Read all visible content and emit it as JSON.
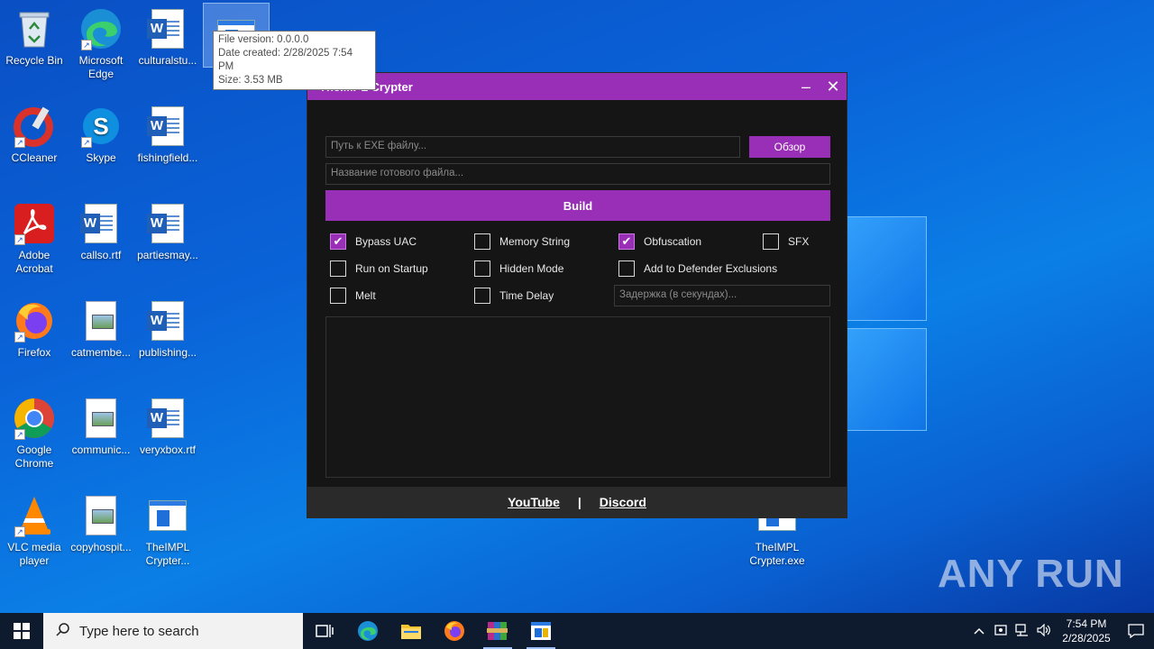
{
  "desktop": {
    "icons": [
      {
        "label": "Recycle Bin"
      },
      {
        "label": "Microsoft Edge"
      },
      {
        "label": "culturalstu..."
      },
      {
        "label": "CCleaner"
      },
      {
        "label": "Skype"
      },
      {
        "label": "fishingfield..."
      },
      {
        "label": "Adobe Acrobat"
      },
      {
        "label": "callso.rtf"
      },
      {
        "label": "partiesmay..."
      },
      {
        "label": "Firefox"
      },
      {
        "label": "catmembe..."
      },
      {
        "label": "publishing..."
      },
      {
        "label": "Google Chrome"
      },
      {
        "label": "communic..."
      },
      {
        "label": "veryxbox.rtf"
      },
      {
        "label": "VLC media player"
      },
      {
        "label": "copyhospit..."
      },
      {
        "label": "TheIMPL Crypter..."
      },
      {
        "label": "TheIMPL Crypter.exe"
      }
    ],
    "tooltip": {
      "line1": "File version: 0.0.0.0",
      "line2": "Date created: 2/28/2025 7:54 PM",
      "line3": "Size: 3.53 MB"
    },
    "watermark": "ANY RUN"
  },
  "app": {
    "title": "TheIMPL Crypter",
    "minimize_glyph": "‒",
    "close_glyph": "✕",
    "exe_path_placeholder": "Путь к EXE файлу...",
    "browse_label": "Обзор",
    "output_name_placeholder": "Название готового файла...",
    "build_label": "Build",
    "options": {
      "bypass_uac": {
        "label": "Bypass UAC",
        "checked": true
      },
      "memory_string": {
        "label": "Memory String",
        "checked": false
      },
      "obfuscation": {
        "label": "Obfuscation",
        "checked": true
      },
      "sfx": {
        "label": "SFX",
        "checked": false
      },
      "run_on_startup": {
        "label": "Run on Startup",
        "checked": false
      },
      "hidden_mode": {
        "label": "Hidden Mode",
        "checked": false
      },
      "defender_exclusions": {
        "label": "Add to Defender Exclusions",
        "checked": false
      },
      "melt": {
        "label": "Melt",
        "checked": false
      },
      "time_delay": {
        "label": "Time Delay",
        "checked": false
      }
    },
    "delay_placeholder": "Задержка (в секундах)...",
    "check_glyph": "✔",
    "footer": {
      "youtube": "YouTube",
      "separator": "|",
      "discord": "Discord"
    }
  },
  "taskbar": {
    "search_placeholder": "Type here to search",
    "time": "7:54 PM",
    "date": "2/28/2025"
  },
  "colors": {
    "accent": "#9a2fb7",
    "window_bg": "#151515",
    "taskbar": "#0e1a2e"
  }
}
